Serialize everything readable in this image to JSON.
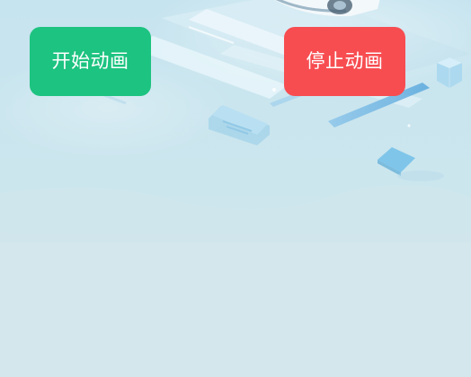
{
  "controls": {
    "start_label": "开始动画",
    "stop_label": "停止动画"
  },
  "colors": {
    "start_button": "#1dc380",
    "stop_button": "#f74d51",
    "background": "#d3e7ec"
  },
  "background": {
    "illustration": "isometric-tech-scene"
  }
}
